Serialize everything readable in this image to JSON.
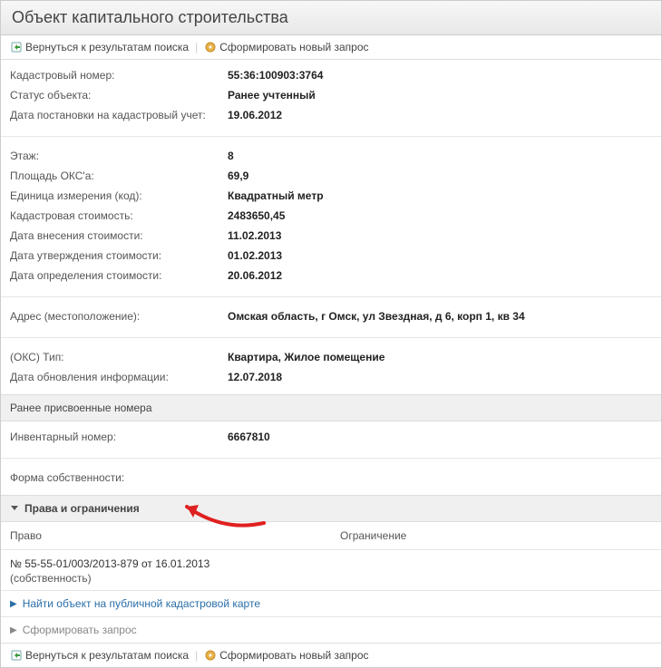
{
  "header": {
    "title": "Объект капитального строительства"
  },
  "toolbar": {
    "back_label": "Вернуться к результатам поиска",
    "new_query_label": "Сформировать новый запрос"
  },
  "props": {
    "cadastral_number": {
      "label": "Кадастровый номер:",
      "value": "55:36:100903:3764"
    },
    "status": {
      "label": "Статус объекта:",
      "value": "Ранее учтенный"
    },
    "reg_date": {
      "label": "Дата постановки на кадастровый учет:",
      "value": "19.06.2012"
    },
    "floor": {
      "label": "Этаж:",
      "value": "8"
    },
    "area": {
      "label": "Площадь ОКС'а:",
      "value": "69,9"
    },
    "unit": {
      "label": "Единица измерения (код):",
      "value": "Квадратный метр"
    },
    "cad_value": {
      "label": "Кадастровая стоимость:",
      "value": "2483650,45"
    },
    "value_entered": {
      "label": "Дата внесения стоимости:",
      "value": "11.02.2013"
    },
    "value_approved": {
      "label": "Дата утверждения стоимости:",
      "value": "01.02.2013"
    },
    "value_determined": {
      "label": "Дата определения стоимости:",
      "value": "20.06.2012"
    },
    "address": {
      "label": "Адрес (местоположение):",
      "value": "Омская область, г Омск, ул Звездная, д 6, корп 1, кв 34"
    },
    "oks_type": {
      "label": "(ОКС) Тип:",
      "value": "Квартира, Жилое помещение"
    },
    "updated": {
      "label": "Дата обновления информации:",
      "value": "12.07.2018"
    }
  },
  "prev_numbers": {
    "heading": "Ранее присвоенные номера",
    "inventory": {
      "label": "Инвентарный номер:",
      "value": "6667810"
    }
  },
  "ownership_form": {
    "label": "Форма собственности:"
  },
  "rights": {
    "heading": "Права и ограничения",
    "col_right": "Право",
    "col_restriction": "Ограничение",
    "entry_number": "№ 55-55-01/003/2013-879  от 16.01.2013",
    "entry_type": "(собственность)"
  },
  "actions": {
    "find_on_map": "Найти объект на публичной кадастровой карте",
    "make_request": "Сформировать запрос"
  }
}
